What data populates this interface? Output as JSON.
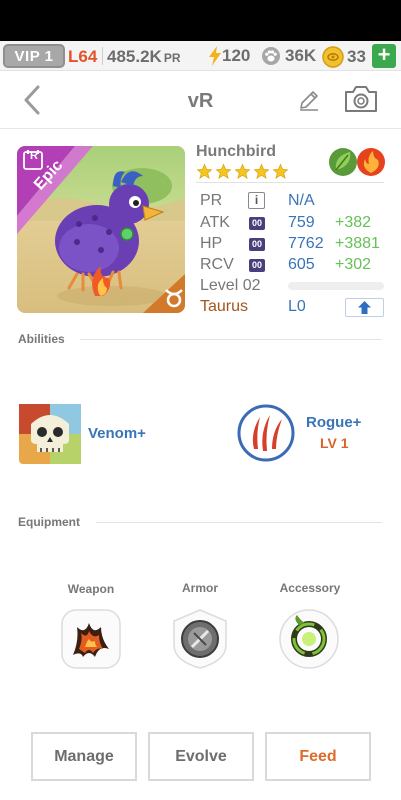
{
  "status": {
    "vip": "VIP 1",
    "level": "L64",
    "power": "485.2K",
    "power_unit": "PR",
    "energy": "120",
    "paws": "36K",
    "coins": "33",
    "add": "+"
  },
  "nav": {
    "title": "vR"
  },
  "monster": {
    "name": "Hunchbird",
    "rarity": "Epic",
    "rarity_badge": "R",
    "stars": 5,
    "elements": [
      "leaf-icon",
      "fire-icon"
    ]
  },
  "stats": {
    "pr_label": "PR",
    "pr_value": "N/A",
    "info": "i",
    "atk_label": "ATK",
    "atk_value": "759",
    "atk_bonus": "+382",
    "hp_label": "HP",
    "hp_value": "7762",
    "hp_bonus": "+3881",
    "rcv_label": "RCV",
    "rcv_value": "605",
    "rcv_bonus": "+302",
    "icon_text": "00",
    "level": "Level 02",
    "sign": "Taurus",
    "sign_level": "L0"
  },
  "abilities": {
    "label": "Abilities",
    "items": [
      {
        "name": "Venom+"
      },
      {
        "name": "Rogue+",
        "level": "LV 1"
      }
    ]
  },
  "equipment": {
    "label": "Equipment",
    "slots": [
      "Weapon",
      "Armor",
      "Accessory"
    ]
  },
  "buttons": {
    "manage": "Manage",
    "evolve": "Evolve",
    "feed": "Feed"
  },
  "colors": {
    "accent_blue": "#3a74b8",
    "bonus_green": "#66c156",
    "level_orange": "#e4532b",
    "feed_orange": "#de6a2b",
    "add_green": "#3aa84b"
  }
}
